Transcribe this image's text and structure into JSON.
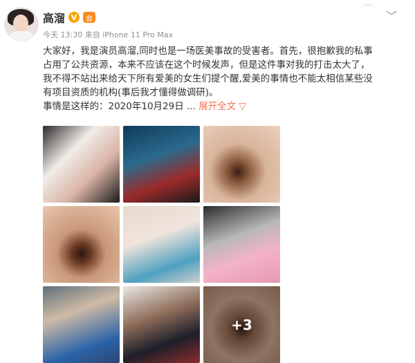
{
  "post": {
    "username": "高溜",
    "verified_badge": "V",
    "level_badge": "会",
    "time": "今天 13:30",
    "source": "来自 iPhone 11 Pro Max",
    "text_lines": [
      "大家好，我是演员高溜,同时也是一场医美事故的受害者。首先，很抱歉我的私事",
      "占用了公共资源，本来不应该在这个时候发声，但是这件事对我的打击太大了，",
      "我不得不站出来给天下所有爱美的女生们提个醒,爱美的事情也不能太相信某些没",
      "有项目资质的机构(事后我才懂得做调研)。",
      "事情是这样的：2020年10月29日 ..."
    ],
    "expand_label": "展开全文",
    "expand_chevron": "▽",
    "more_images_label": "+3"
  },
  "icons": {
    "chevron": "chevron-down-icon",
    "verified": "verified-icon",
    "level": "level-badge-icon"
  },
  "colors": {
    "link": "#eb7350",
    "verified": "#f7a400",
    "meta": "#8f8f8f"
  }
}
